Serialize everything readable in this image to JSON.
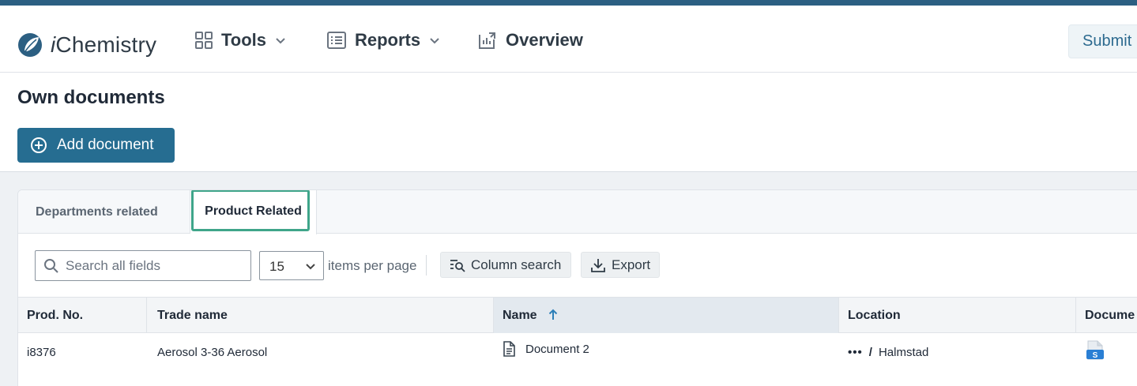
{
  "brand": {
    "name_prefix": "i",
    "name_rest": "Chemistry",
    "logo_icon": "ichemistry-leaf-logo"
  },
  "nav": {
    "tools_label": "Tools",
    "reports_label": "Reports",
    "overview_label": "Overview",
    "submit_label": "Submit"
  },
  "page": {
    "title": "Own documents",
    "add_button_label": "Add document"
  },
  "tabs": [
    {
      "label": "Departments related",
      "active": false
    },
    {
      "label": "Product Related",
      "active": true
    }
  ],
  "toolbar": {
    "search_placeholder": "Search all fields",
    "per_page_value": "15",
    "per_page_label": "items per page",
    "column_search_label": "Column search",
    "export_label": "Export"
  },
  "table": {
    "columns": [
      "Prod. No.",
      "Trade name",
      "Name",
      "Location",
      "Docume"
    ],
    "sorted_column": "Name",
    "sort_direction": "ascending",
    "rows": [
      {
        "prod_no": "i8376",
        "trade_name": "Aerosol 3-36 Aerosol",
        "name": "Document 2",
        "location_ellipsis": "•••",
        "location_separator": "/",
        "location": "Halmstad",
        "document_badge": "S"
      }
    ]
  },
  "colors": {
    "accent_bar": "#2c5f82",
    "primary_button": "#266d91",
    "focus_ring": "#3fa58a",
    "sort_arrow": "#2c7fb8"
  }
}
